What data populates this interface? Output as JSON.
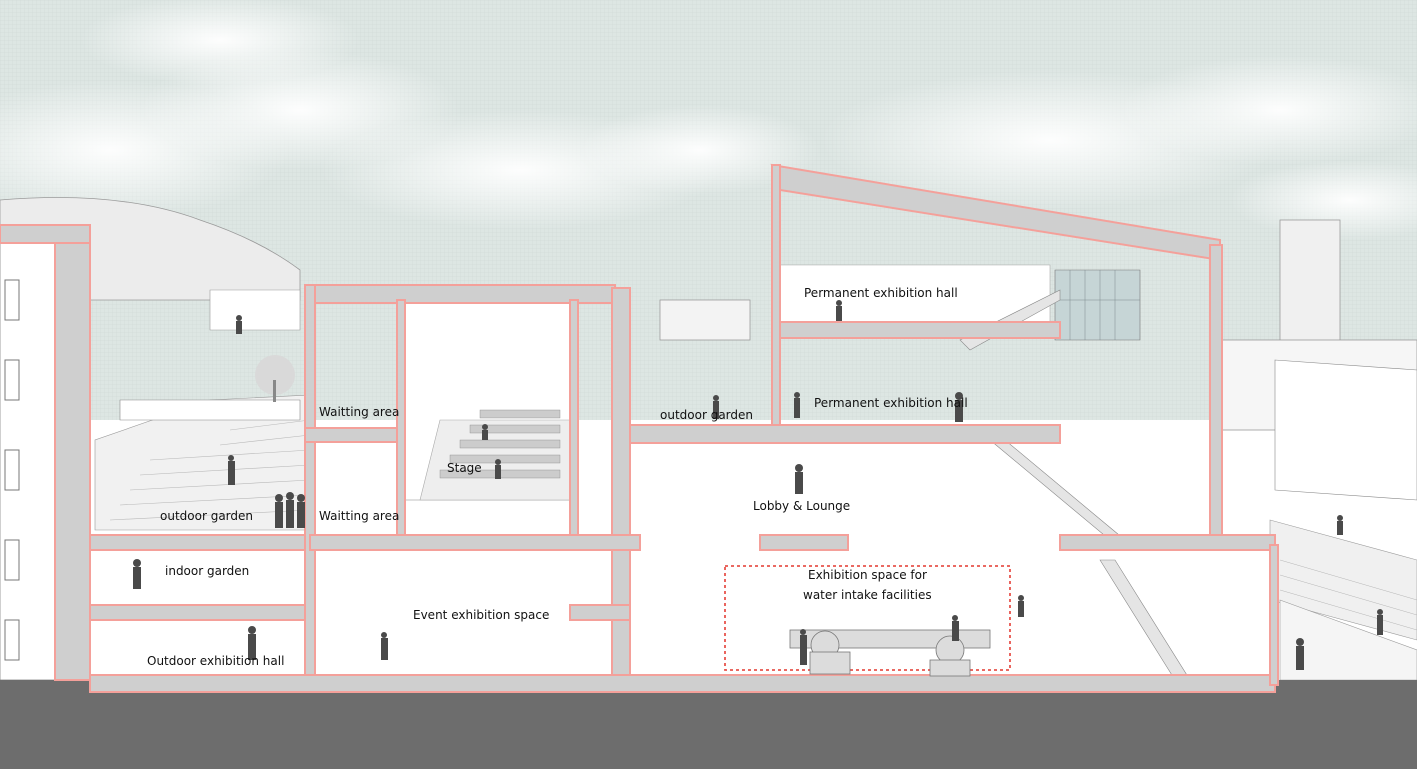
{
  "labels": {
    "permanent_exhibition_hall_top": "Permanent exhibition hall",
    "permanent_exhibition_hall_mid": "Permanent exhibition hall",
    "waiting_area_upper": "Waitting area",
    "waiting_area_lower": "Waitting area",
    "stage": "Stage",
    "outdoor_garden_left": "outdoor garden",
    "outdoor_garden_center": "outdoor garden",
    "lobby_lounge": "Lobby & Lounge",
    "indoor_garden": "indoor garden",
    "event_exhibition_space": "Event exhibition space",
    "outdoor_exhibition_hall": "Outdoor exhibition hall",
    "water_intake_line1": "Exhibition space for",
    "water_intake_line2": "water intake facilities"
  },
  "colors": {
    "section_cut": "#f4a09a",
    "wall_fill": "#cfcfcf",
    "ground": "#6d6d6d",
    "sky": "#dde6e3",
    "dotted_frame": "#e8544c",
    "people": "#4a4a4a"
  }
}
